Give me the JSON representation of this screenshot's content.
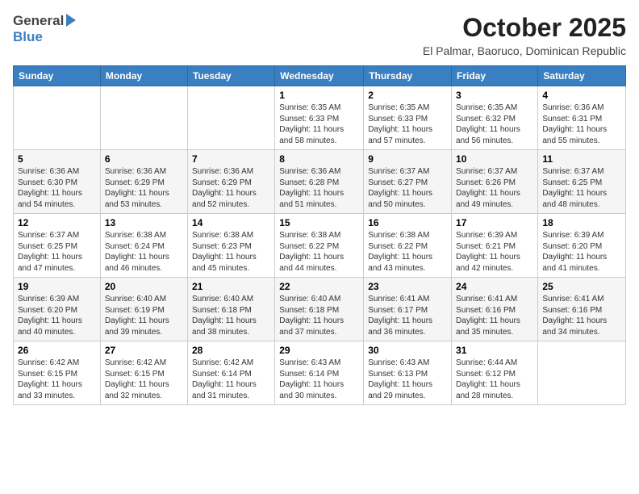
{
  "logo": {
    "general": "General",
    "blue": "Blue"
  },
  "title": "October 2025",
  "location": "El Palmar, Baoruco, Dominican Republic",
  "weekdays": [
    "Sunday",
    "Monday",
    "Tuesday",
    "Wednesday",
    "Thursday",
    "Friday",
    "Saturday"
  ],
  "weeks": [
    [
      null,
      null,
      null,
      {
        "day": 1,
        "sunrise": "6:35 AM",
        "sunset": "6:33 PM",
        "daylight": "11 hours and 58 minutes."
      },
      {
        "day": 2,
        "sunrise": "6:35 AM",
        "sunset": "6:33 PM",
        "daylight": "11 hours and 57 minutes."
      },
      {
        "day": 3,
        "sunrise": "6:35 AM",
        "sunset": "6:32 PM",
        "daylight": "11 hours and 56 minutes."
      },
      {
        "day": 4,
        "sunrise": "6:36 AM",
        "sunset": "6:31 PM",
        "daylight": "11 hours and 55 minutes."
      }
    ],
    [
      {
        "day": 5,
        "sunrise": "6:36 AM",
        "sunset": "6:30 PM",
        "daylight": "11 hours and 54 minutes."
      },
      {
        "day": 6,
        "sunrise": "6:36 AM",
        "sunset": "6:29 PM",
        "daylight": "11 hours and 53 minutes."
      },
      {
        "day": 7,
        "sunrise": "6:36 AM",
        "sunset": "6:29 PM",
        "daylight": "11 hours and 52 minutes."
      },
      {
        "day": 8,
        "sunrise": "6:36 AM",
        "sunset": "6:28 PM",
        "daylight": "11 hours and 51 minutes."
      },
      {
        "day": 9,
        "sunrise": "6:37 AM",
        "sunset": "6:27 PM",
        "daylight": "11 hours and 50 minutes."
      },
      {
        "day": 10,
        "sunrise": "6:37 AM",
        "sunset": "6:26 PM",
        "daylight": "11 hours and 49 minutes."
      },
      {
        "day": 11,
        "sunrise": "6:37 AM",
        "sunset": "6:25 PM",
        "daylight": "11 hours and 48 minutes."
      }
    ],
    [
      {
        "day": 12,
        "sunrise": "6:37 AM",
        "sunset": "6:25 PM",
        "daylight": "11 hours and 47 minutes."
      },
      {
        "day": 13,
        "sunrise": "6:38 AM",
        "sunset": "6:24 PM",
        "daylight": "11 hours and 46 minutes."
      },
      {
        "day": 14,
        "sunrise": "6:38 AM",
        "sunset": "6:23 PM",
        "daylight": "11 hours and 45 minutes."
      },
      {
        "day": 15,
        "sunrise": "6:38 AM",
        "sunset": "6:22 PM",
        "daylight": "11 hours and 44 minutes."
      },
      {
        "day": 16,
        "sunrise": "6:38 AM",
        "sunset": "6:22 PM",
        "daylight": "11 hours and 43 minutes."
      },
      {
        "day": 17,
        "sunrise": "6:39 AM",
        "sunset": "6:21 PM",
        "daylight": "11 hours and 42 minutes."
      },
      {
        "day": 18,
        "sunrise": "6:39 AM",
        "sunset": "6:20 PM",
        "daylight": "11 hours and 41 minutes."
      }
    ],
    [
      {
        "day": 19,
        "sunrise": "6:39 AM",
        "sunset": "6:20 PM",
        "daylight": "11 hours and 40 minutes."
      },
      {
        "day": 20,
        "sunrise": "6:40 AM",
        "sunset": "6:19 PM",
        "daylight": "11 hours and 39 minutes."
      },
      {
        "day": 21,
        "sunrise": "6:40 AM",
        "sunset": "6:18 PM",
        "daylight": "11 hours and 38 minutes."
      },
      {
        "day": 22,
        "sunrise": "6:40 AM",
        "sunset": "6:18 PM",
        "daylight": "11 hours and 37 minutes."
      },
      {
        "day": 23,
        "sunrise": "6:41 AM",
        "sunset": "6:17 PM",
        "daylight": "11 hours and 36 minutes."
      },
      {
        "day": 24,
        "sunrise": "6:41 AM",
        "sunset": "6:16 PM",
        "daylight": "11 hours and 35 minutes."
      },
      {
        "day": 25,
        "sunrise": "6:41 AM",
        "sunset": "6:16 PM",
        "daylight": "11 hours and 34 minutes."
      }
    ],
    [
      {
        "day": 26,
        "sunrise": "6:42 AM",
        "sunset": "6:15 PM",
        "daylight": "11 hours and 33 minutes."
      },
      {
        "day": 27,
        "sunrise": "6:42 AM",
        "sunset": "6:15 PM",
        "daylight": "11 hours and 32 minutes."
      },
      {
        "day": 28,
        "sunrise": "6:42 AM",
        "sunset": "6:14 PM",
        "daylight": "11 hours and 31 minutes."
      },
      {
        "day": 29,
        "sunrise": "6:43 AM",
        "sunset": "6:14 PM",
        "daylight": "11 hours and 30 minutes."
      },
      {
        "day": 30,
        "sunrise": "6:43 AM",
        "sunset": "6:13 PM",
        "daylight": "11 hours and 29 minutes."
      },
      {
        "day": 31,
        "sunrise": "6:44 AM",
        "sunset": "6:12 PM",
        "daylight": "11 hours and 28 minutes."
      },
      null
    ]
  ]
}
